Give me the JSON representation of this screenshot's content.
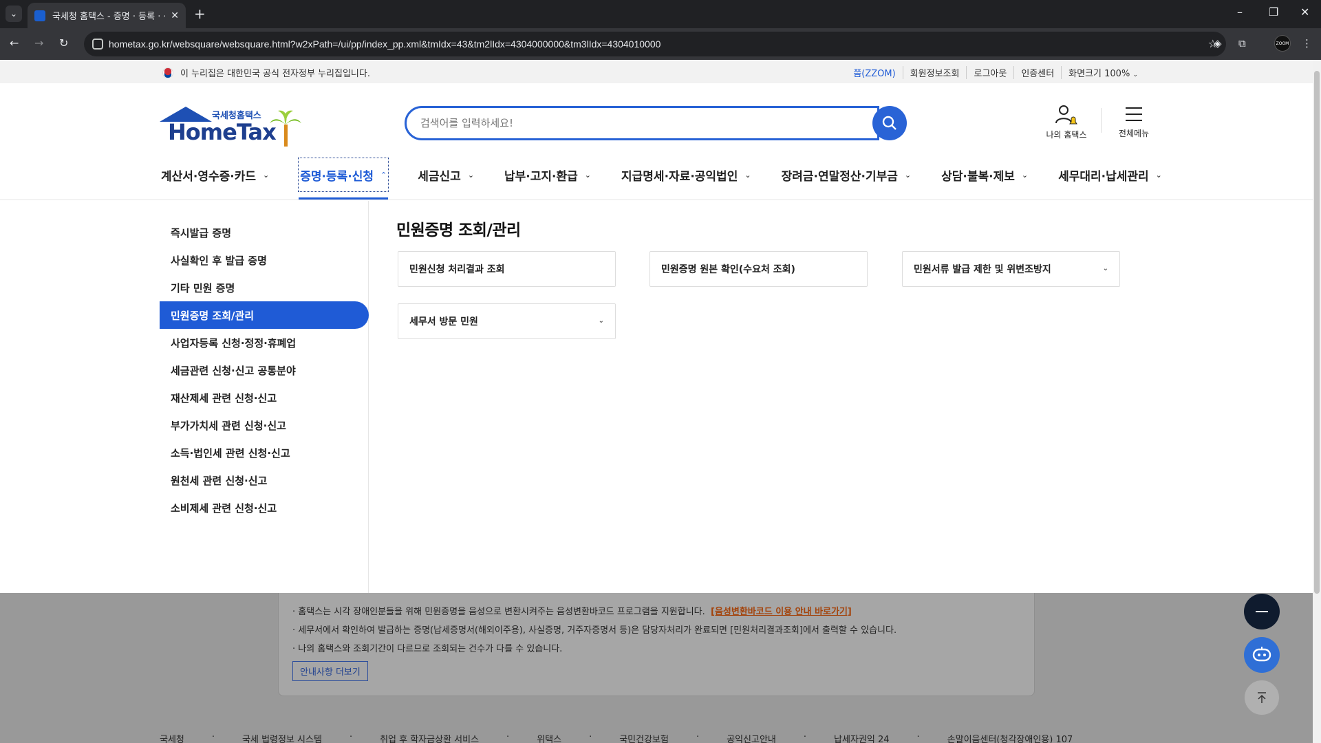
{
  "browser": {
    "tab_title": "국세청 홈택스 - 증명 · 등록 · 신",
    "url": "hometax.go.kr/websquare/websquare.html?w2xPath=/ui/pp/index_pp.xml&tmIdx=43&tm2lIdx=4304000000&tm3lIdx=4304010000",
    "zoom_ext_label": "ZOOM"
  },
  "gov_bar": {
    "notice": "이 누리집은 대한민국 공식 전자정부 누리집입니다.",
    "links": [
      "쯤(ZZOM)",
      "회원정보조회",
      "로그아웃",
      "인증센터",
      "화면크기 100%"
    ]
  },
  "header": {
    "logo_sub": "국세청홈택스",
    "logo_main": "HomeTax",
    "search_placeholder": "검색어를 입력하세요!",
    "my_hometax": "나의 홈택스",
    "all_menu": "전체메뉴"
  },
  "gnb": [
    "계산서·영수증·카드",
    "증명·등록·신청",
    "세금신고",
    "납부·고지·환급",
    "지급명세·자료·공익법인",
    "장려금·연말정산·기부금",
    "상담·불복·제보",
    "세무대리·납세관리"
  ],
  "lnb": [
    "즉시발급 증명",
    "사실확인 후 발급 증명",
    "기타 민원 증명",
    "민원증명 조회/관리",
    "사업자등록 신청·정정·휴폐업",
    "세금관련 신청·신고 공통분야",
    "재산제세 관련 신청·신고",
    "부가가치세 관련 신청·신고",
    "소득·법인세 관련 신청·신고",
    "원천세 관련 신청·신고",
    "소비제세 관련 신청·신고"
  ],
  "content": {
    "title": "민원증명 조회/관리",
    "cards": [
      "민원신청 처리결과 조회",
      "민원증명 원본 확인(수요처 조회)",
      "민원서류 발급 제한 및 위변조방지",
      "세무서 방문 민원"
    ]
  },
  "notice": {
    "line1": "· 홈택스는 시각 장애인분들을 위해 민원증명을 음성으로 변환시켜주는 음성변환바코드 프로그램을 지원합니다.",
    "line1_link": "[음성변환바코드 이용 안내 바로가기]",
    "line2": "· 세무서에서 확인하여 발급하는 증명(납세증명서(해외이주용), 사실증명, 거주자증명서 등)은 담당자처리가 완료되면 [민원처리결과조회]에서 출력할 수 있습니다.",
    "line3": "· 나의 홈택스와 조회기간이 다르므로 조회되는 건수가 다를 수 있습니다.",
    "more_button": "안내사항 더보기"
  },
  "footer_links": [
    "국세청",
    "국세 법령정보 시스템",
    "취업 후 학자금상환 서비스",
    "위택스",
    "국민건강보험",
    "공익신고안내",
    "납세자권익 24",
    "손말이음센터(청각장애인용) 107"
  ],
  "colors": {
    "primary": "#1f5bd6",
    "gnb_active": "#1e5bd6",
    "overlay": "#999999"
  }
}
